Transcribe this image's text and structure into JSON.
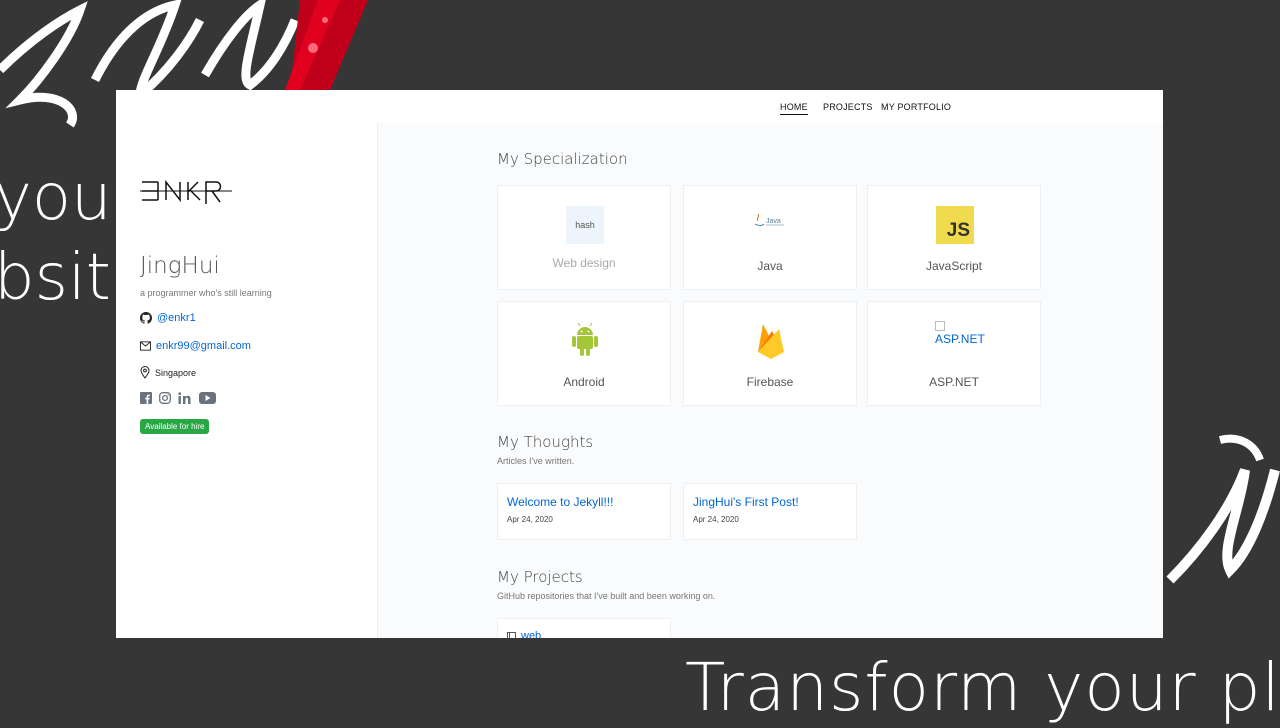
{
  "background": {
    "text_line1": "your",
    "text_line2": "bsite",
    "bottom_text": "Transform your plai"
  },
  "nav": {
    "home": "HOME",
    "projects": "PROJECTS",
    "portfolio": "MY PORTFOLIO"
  },
  "profile": {
    "logo_alt": "ENKR",
    "name": "JingHui",
    "tagline": "a programmer who's still learning",
    "github": "@enkr1",
    "email": "enkr99@gmail.com",
    "location": "Singapore",
    "hire_badge": "Available for hire",
    "social_icons": [
      "facebook-icon",
      "instagram-icon",
      "linkedin-icon",
      "youtube-icon"
    ]
  },
  "specialization": {
    "title": "My Specialization",
    "items": [
      {
        "label": "Web design",
        "icon": "hash"
      },
      {
        "label": "Java",
        "icon": "java-logo"
      },
      {
        "label": "JavaScript",
        "icon": "JS"
      },
      {
        "label": "Android",
        "icon": "android-logo"
      },
      {
        "label": "Firebase",
        "icon": "firebase-logo"
      },
      {
        "label": "ASP.NET",
        "icon": "ASP.NET"
      }
    ]
  },
  "thoughts": {
    "title": "My Thoughts",
    "subtitle": "Articles I've written.",
    "posts": [
      {
        "title": "Welcome to Jekyll!!!",
        "date": "Apr 24, 2020"
      },
      {
        "title": "JingHui's First Post!",
        "date": "Apr 24, 2020"
      }
    ]
  },
  "projects": {
    "title": "My Projects",
    "subtitle": "GitHub repositories that I've built and been working on.",
    "repos": [
      {
        "name": "web"
      }
    ]
  },
  "colors": {
    "accent_link": "#0366d6",
    "hire_green": "#28a745",
    "js_yellow": "#f0db4f",
    "android_green": "#a4c639",
    "background": "#363636"
  }
}
